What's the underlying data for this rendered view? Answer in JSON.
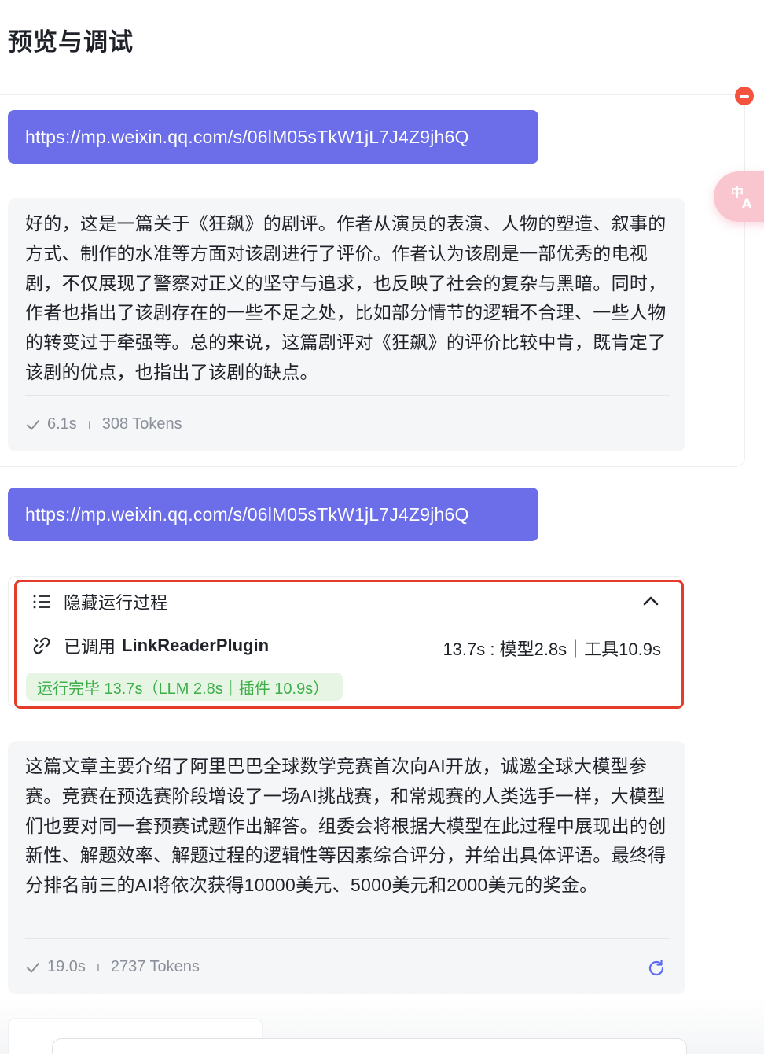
{
  "page": {
    "title": "预览与调试"
  },
  "colors": {
    "user_bubble": "#6b6ee8",
    "accent_red": "#e53b2a",
    "success_green": "#3dae4a",
    "refresh_blue": "#5b6cf0",
    "remove_red": "#f5533d"
  },
  "conversation": {
    "messages": [
      {
        "role": "user",
        "text": "https://mp.weixin.qq.com/s/06lM05sTkW1jL7J4Z9jh6Q"
      },
      {
        "role": "assistant",
        "text": "好的，这是一篇关于《狂飙》的剧评。作者从演员的表演、人物的塑造、叙事的方式、制作的水准等方面对该剧进行了评价。作者认为该剧是一部优秀的电视剧，不仅展现了警察对正义的坚守与追求，也反映了社会的复杂与黑暗。同时，作者也指出了该剧存在的一些不足之处，比如部分情节的逻辑不合理、一些人物的转变过于牵强等。总的来说，这篇剧评对《狂飙》的评价比较中肯，既肯定了该剧的优点，也指出了该剧的缺点。",
        "time": "6.1s",
        "tokens": "308 Tokens"
      },
      {
        "role": "user",
        "text": "https://mp.weixin.qq.com/s/06lM05sTkW1jL7J4Z9jh6Q"
      },
      {
        "role": "assistant",
        "process": {
          "toggle_label": "隐藏运行过程",
          "called_label": "已调用",
          "plugin_name": "LinkReaderPlugin",
          "timing": "13.7s : 模型2.8s｜工具10.9s",
          "status": "运行完毕 13.7s（LLM 2.8s｜插件 10.9s）"
        },
        "text": "这篇文章主要介绍了阿里巴巴全球数学竞赛首次向AI开放，诚邀全球大模型参赛。竞赛在预选赛阶段增设了一场AI挑战赛，和常规赛的人类选手一样，大模型们也要对同一套预赛试题作出解答。组委会将根据大模型在此过程中展现出的创新性、解题效率、解题过程的逻辑性等因素综合评分，并给出具体评语。最终得分排名前三的AI将依次获得10000美元、5000美元和2000美元的奖金。",
        "time": "19.0s",
        "tokens": "2737 Tokens"
      }
    ]
  }
}
